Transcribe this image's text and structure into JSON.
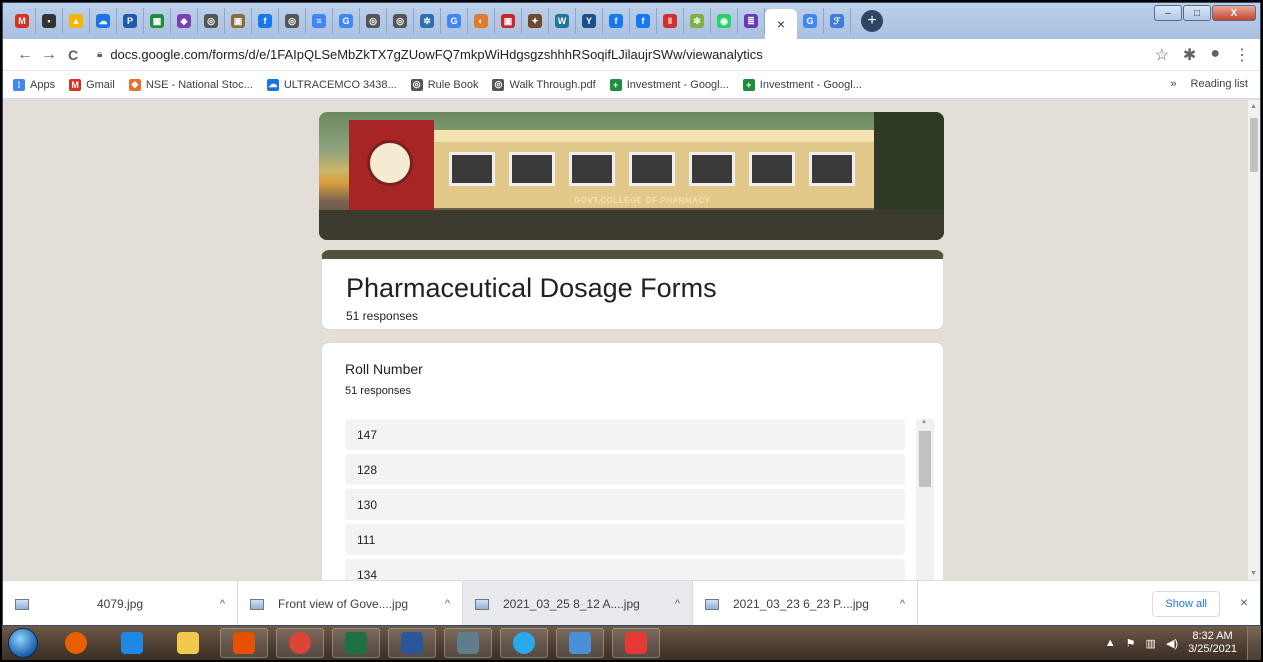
{
  "browser": {
    "url": "docs.google.com/forms/d/e/1FAIpQLSeMbZkTX7gZUowFQ7mkpWiHdgsgzshhhRSoqifLJilaujrSWw/viewanalytics",
    "active_tab_close": "×",
    "new_tab": "+",
    "window_controls": {
      "minimize": "–",
      "maximize": "□",
      "close": "X"
    },
    "nav": {
      "back": "←",
      "forward": "→",
      "reload": "C"
    },
    "addr_icons": {
      "star": "☆",
      "extensions": "✱",
      "profile": "●",
      "menu": "⋮"
    }
  },
  "tabs": [
    {
      "icon": "gmail-icon",
      "color": "#d93025",
      "glyph": "M"
    },
    {
      "icon": "slides-icon",
      "color": "#333",
      "glyph": "▪"
    },
    {
      "icon": "drive-icon",
      "color": "#f4b400",
      "glyph": "▲"
    },
    {
      "icon": "cloud-icon",
      "color": "#1a73e8",
      "glyph": "☁"
    },
    {
      "icon": "p-icon",
      "color": "#1e5aa8",
      "glyph": "P"
    },
    {
      "icon": "sheets-icon",
      "color": "#1e8e3e",
      "glyph": "▦"
    },
    {
      "icon": "hat-icon",
      "color": "#7b3fb5",
      "glyph": "◆"
    },
    {
      "icon": "globe-icon",
      "color": "#555",
      "glyph": "◎"
    },
    {
      "icon": "image-icon",
      "color": "#8a6d3b",
      "glyph": "▣"
    },
    {
      "icon": "facebook-icon",
      "color": "#1877f2",
      "glyph": "f"
    },
    {
      "icon": "globe-icon",
      "color": "#555",
      "glyph": "◎"
    },
    {
      "icon": "docs-icon",
      "color": "#4285f4",
      "glyph": "≡"
    },
    {
      "icon": "google-icon",
      "color": "#4285f4",
      "glyph": "G"
    },
    {
      "icon": "globe-icon",
      "color": "#555",
      "glyph": "◎"
    },
    {
      "icon": "globe-icon",
      "color": "#555",
      "glyph": "◎"
    },
    {
      "icon": "gear-icon",
      "color": "#2a6fb0",
      "glyph": "✲"
    },
    {
      "icon": "google-icon",
      "color": "#4285f4",
      "glyph": "G"
    },
    {
      "icon": "chat-icon",
      "color": "#e07a2e",
      "glyph": "◐"
    },
    {
      "icon": "red-square-icon",
      "color": "#c62828",
      "glyph": "▣"
    },
    {
      "icon": "badge-icon",
      "color": "#6b4a2e",
      "glyph": "✦"
    },
    {
      "icon": "wordpress-icon",
      "color": "#21759b",
      "glyph": "W"
    },
    {
      "icon": "y-icon",
      "color": "#1a4f8b",
      "glyph": "Y"
    },
    {
      "icon": "facebook-icon",
      "color": "#1877f2",
      "glyph": "f"
    },
    {
      "icon": "facebook-icon",
      "color": "#1877f2",
      "glyph": "f"
    },
    {
      "icon": "pause-icon",
      "color": "#d32f2f",
      "glyph": "‖"
    },
    {
      "icon": "circle-icon",
      "color": "#7cb342",
      "glyph": "✼"
    },
    {
      "icon": "whatsapp-icon",
      "color": "#25d366",
      "glyph": "◉"
    },
    {
      "icon": "forms-icon",
      "color": "#673ab7",
      "glyph": "≣"
    }
  ],
  "trailing_tabs": [
    {
      "icon": "google-icon",
      "color": "#4285f4",
      "glyph": "G"
    },
    {
      "icon": "leaf-icon",
      "color": "#3b7dd8",
      "glyph": "ℱ"
    }
  ],
  "bookmarks": [
    {
      "name": "apps",
      "label": "Apps",
      "color": "#4285f4",
      "glyph": "⁞"
    },
    {
      "name": "gmail",
      "label": "Gmail",
      "color": "#d93025",
      "glyph": "M"
    },
    {
      "name": "nse",
      "label": "NSE - National Stoc...",
      "color": "#e8712a",
      "glyph": "◆"
    },
    {
      "name": "ultracemco",
      "label": "ULTRACEMCO 3438...",
      "color": "#1a73e8",
      "glyph": "☁"
    },
    {
      "name": "rule-book",
      "label": "Rule Book",
      "color": "#555",
      "glyph": "◎"
    },
    {
      "name": "walk-through",
      "label": "Walk Through.pdf",
      "color": "#555",
      "glyph": "◎"
    },
    {
      "name": "investment-1",
      "label": "Investment - Googl...",
      "color": "#1e8e3e",
      "glyph": "+"
    },
    {
      "name": "investment-2",
      "label": "Investment - Googl...",
      "color": "#1e8e3e",
      "glyph": "+"
    }
  ],
  "bookmarks_more": "»",
  "reading_list": "Reading list",
  "form": {
    "banner_sign": "GOVT.COLLEGE OF PHARMACY",
    "title": "Pharmaceutical Dosage Forms",
    "responses": "51 responses",
    "accent": "#56513f",
    "question": {
      "title": "Roll Number",
      "responses": "51 responses",
      "answers": [
        "147",
        "128",
        "130",
        "111",
        "134"
      ]
    }
  },
  "downloads": [
    {
      "name": "4079.jpg",
      "width": 235
    },
    {
      "name": "Front view of Gove....jpg",
      "width": 225
    },
    {
      "name": "2021_03_25 8_12 A....jpg",
      "width": 230
    },
    {
      "name": "2021_03_23 6_23 P....jpg",
      "width": 225
    }
  ],
  "downloads_show_all": "Show all",
  "downloads_close": "×",
  "taskbar": {
    "apps": [
      "firefox-icon",
      "ie-icon",
      "explorer-icon",
      "media-icon",
      "chrome-icon",
      "excel-icon",
      "word-icon",
      "calculator-icon",
      "telegram-icon",
      "photos-icon",
      "paint-icon"
    ],
    "time": "8:32 AM",
    "date": "3/25/2021"
  }
}
